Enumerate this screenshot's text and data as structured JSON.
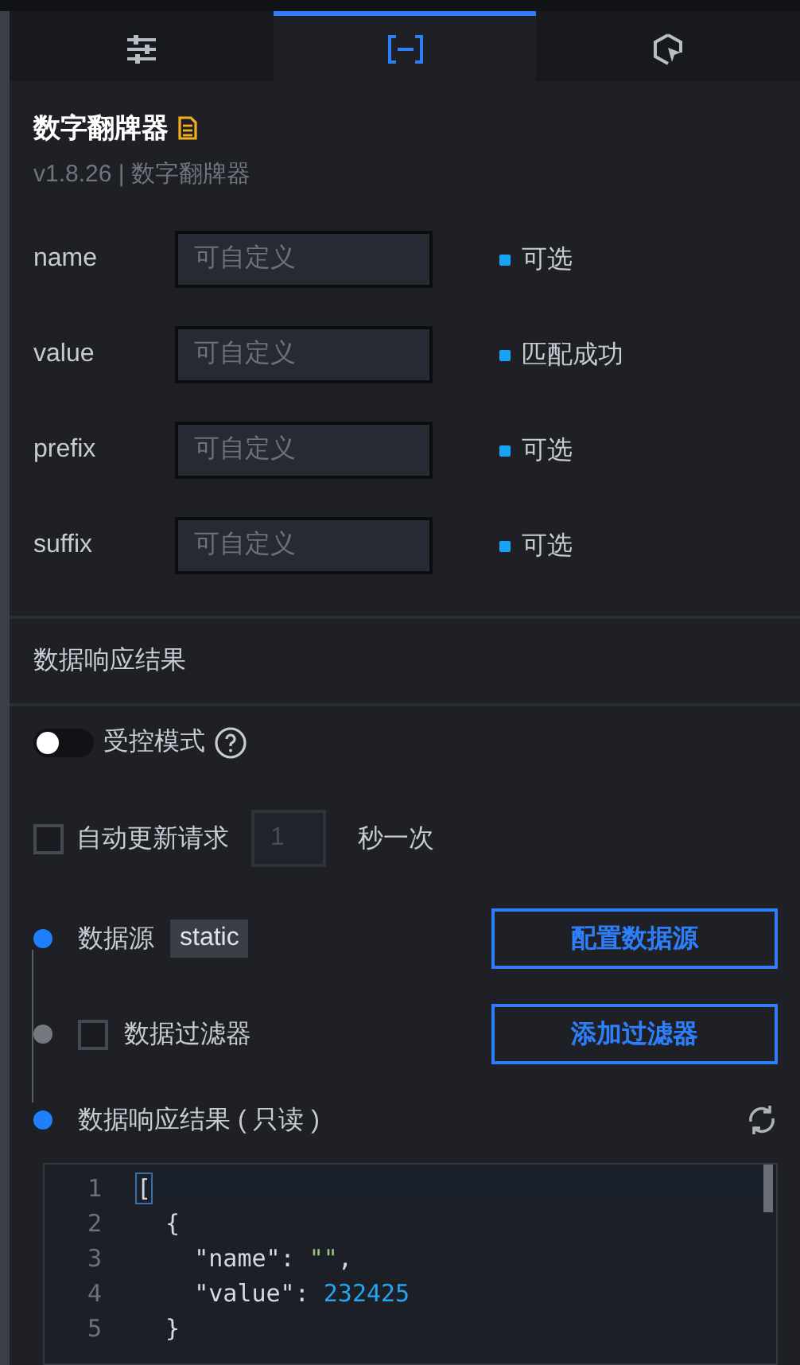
{
  "tabs": [
    {
      "kind": "settings",
      "selected": false
    },
    {
      "kind": "data",
      "selected": true
    },
    {
      "kind": "interaction",
      "selected": false
    }
  ],
  "component": {
    "title": "数字翻牌器",
    "subtitle": "v1.8.26 | 数字翻牌器"
  },
  "fields": [
    {
      "label": "name",
      "placeholder": "可自定义",
      "status": "可选"
    },
    {
      "label": "value",
      "placeholder": "可自定义",
      "status": "匹配成功"
    },
    {
      "label": "prefix",
      "placeholder": "可自定义",
      "status": "可选"
    },
    {
      "label": "suffix",
      "placeholder": "可自定义",
      "status": "可选"
    }
  ],
  "section_title": "数据响应结果",
  "controlled_mode": {
    "label": "受控模式",
    "on": false
  },
  "auto_update": {
    "label": "自动更新请求",
    "checked": false,
    "interval_placeholder": "1",
    "unit": "秒一次"
  },
  "steps": [
    {
      "kind": "source",
      "label": "数据源",
      "active": true,
      "tag": "static",
      "button": "配置数据源"
    },
    {
      "kind": "filter",
      "label": "数据过滤器",
      "active": false,
      "checked": false,
      "button": "添加过滤器"
    },
    {
      "kind": "result",
      "label": "数据响应结果 ( 只读 )",
      "active": true
    }
  ],
  "code_lines": [
    {
      "number": "1",
      "tokens": [
        {
          "kind": "bracket",
          "text": "["
        }
      ]
    },
    {
      "number": "2",
      "tokens": [
        {
          "kind": "punct",
          "text": "  {"
        }
      ]
    },
    {
      "number": "3",
      "tokens": [
        {
          "kind": "punct",
          "text": "    \"name\": "
        },
        {
          "kind": "string",
          "text": "\"\""
        },
        {
          "kind": "punct",
          "text": ","
        }
      ]
    },
    {
      "number": "4",
      "tokens": [
        {
          "kind": "punct",
          "text": "    \"value\": "
        },
        {
          "kind": "number",
          "text": "232425"
        }
      ]
    },
    {
      "number": "5",
      "tokens": [
        {
          "kind": "punct",
          "text": "  }"
        }
      ]
    }
  ]
}
